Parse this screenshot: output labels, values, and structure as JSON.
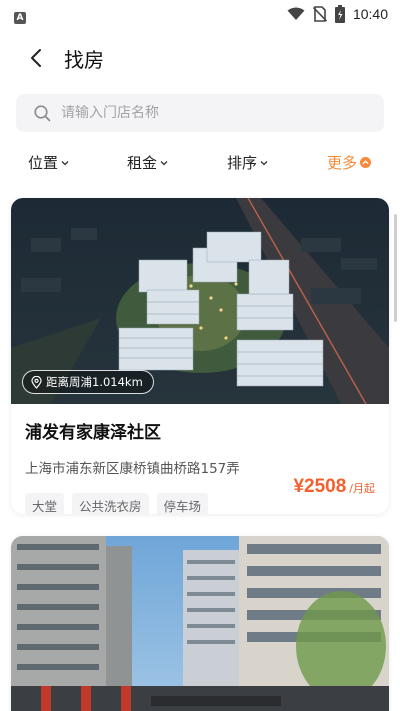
{
  "status_bar": {
    "time": "10:40",
    "app_glyph": "A",
    "icons": [
      "wifi-icon",
      "no-sim-icon",
      "battery-charging-icon"
    ]
  },
  "header": {
    "title": "找房",
    "back_icon": "chevron-left-icon"
  },
  "search": {
    "placeholder": "请输入门店名称",
    "icon": "search-icon"
  },
  "filters": [
    {
      "label": "位置",
      "icon": "chevron-down-icon"
    },
    {
      "label": "租金",
      "icon": "chevron-down-icon"
    },
    {
      "label": "排序",
      "icon": "chevron-down-icon"
    },
    {
      "label": "更多",
      "icon": "chevron-down-circle-icon"
    }
  ],
  "colors": {
    "accent": "#f58a3a",
    "price": "#f5602f",
    "search_bg": "#f4f4f6"
  },
  "listings": [
    {
      "distance": "距离周浦1.014km",
      "name": "浦发有家康泽社区",
      "address": "上海市浦东新区康桥镇曲桥路157弄",
      "tags": [
        "大堂",
        "公共洗衣房",
        "停车场"
      ],
      "price": "¥2508",
      "price_unit": "/月起"
    },
    {
      "distance": "",
      "name": "",
      "address": "",
      "tags": [],
      "price": "",
      "price_unit": ""
    }
  ]
}
